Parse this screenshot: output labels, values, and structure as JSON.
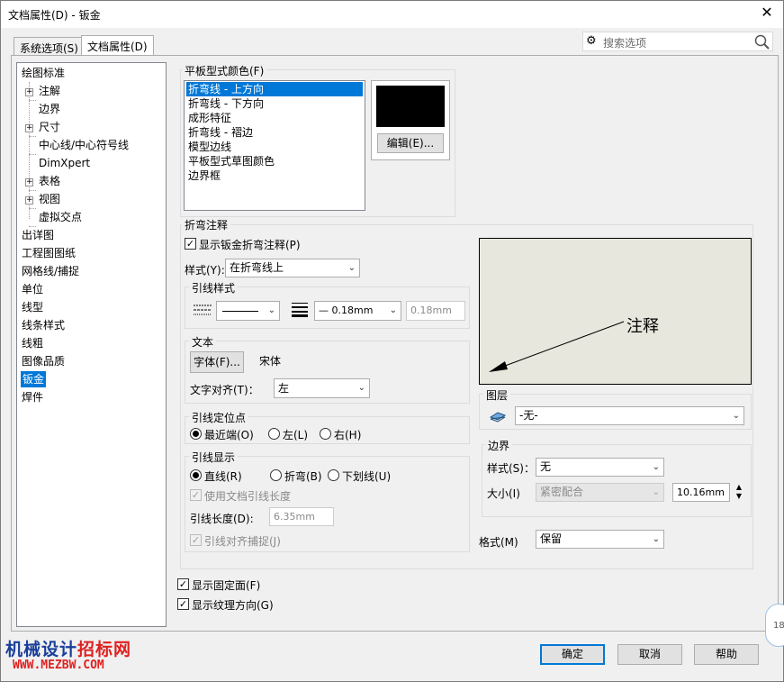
{
  "window": {
    "title": "文档属性(D) - 钣金"
  },
  "tabs": [
    {
      "label": "系统选项(S)"
    },
    {
      "label": "文档属性(D)"
    }
  ],
  "search": {
    "placeholder": "搜索选项"
  },
  "tree": {
    "items": [
      {
        "label": "绘图标准"
      },
      {
        "label": "注解"
      },
      {
        "label": "边界"
      },
      {
        "label": "尺寸"
      },
      {
        "label": "中心线/中心符号线"
      },
      {
        "label": "DimXpert"
      },
      {
        "label": "表格"
      },
      {
        "label": "视图"
      },
      {
        "label": "虚拟交点"
      },
      {
        "label": "出详图"
      },
      {
        "label": "工程图图纸"
      },
      {
        "label": "网格线/捕捉"
      },
      {
        "label": "单位"
      },
      {
        "label": "线型"
      },
      {
        "label": "线条样式"
      },
      {
        "label": "线粗"
      },
      {
        "label": "图像品质"
      },
      {
        "label": "钣金"
      },
      {
        "label": "焊件"
      }
    ]
  },
  "flat_pattern_colors": {
    "label": "平板型式颜色(F)",
    "items": [
      {
        "label": "折弯线 - 上方向"
      },
      {
        "label": "折弯线 - 下方向"
      },
      {
        "label": "成形特征"
      },
      {
        "label": "折弯线 - 褶边"
      },
      {
        "label": "模型边线"
      },
      {
        "label": "平板型式草图颜色"
      },
      {
        "label": "边界框"
      }
    ],
    "swatch_color": "#000000",
    "edit_button": "编辑(E)..."
  },
  "bend_notes": {
    "label": "折弯注释",
    "show_checkbox": "显示钣金折弯注释(P)",
    "style_label": "样式(Y):",
    "style_value": "在折弯线上",
    "leader_style": {
      "label": "引线样式",
      "thickness_value": "0.18mm",
      "custom_value": "0.18mm"
    },
    "text": {
      "label": "文本",
      "font_button": "字体(F)...",
      "font_name": "宋体",
      "align_label": "文字对齐(T)：",
      "align_value": "左"
    },
    "anchor": {
      "label": "引线定位点",
      "options": [
        "最近端(O)",
        "左(L)",
        "右(H)"
      ]
    },
    "leader_display": {
      "label": "引线显示",
      "options": [
        "直线(R)",
        "折弯(B)",
        "下划线(U)"
      ],
      "use_doc_length": "使用文档引线长度",
      "length_label": "引线长度(D):",
      "length_value": "6.35mm",
      "snap": "引线对齐捕捉(J)"
    },
    "preview_text": "注释",
    "layer": {
      "label": "图层",
      "value": "-无-"
    },
    "border": {
      "label": "边界",
      "style_label": "样式(S)：",
      "style_value": "无",
      "size_label": "大小(I)",
      "size_value": "紧密配合",
      "size_input": "10.16mm"
    },
    "format_label": "格式(M)",
    "format_value": "保留"
  },
  "show_fixed_face": "显示固定面(F)",
  "show_grain": "显示纹理方向(G)",
  "buttons": {
    "ok": "确定",
    "cancel": "取消",
    "help": "帮助"
  },
  "watermark": {
    "line1a": "机械设计",
    "line1b": "招标网",
    "line2": "WWW.MEZBW.COM"
  },
  "edge_badge": "18"
}
